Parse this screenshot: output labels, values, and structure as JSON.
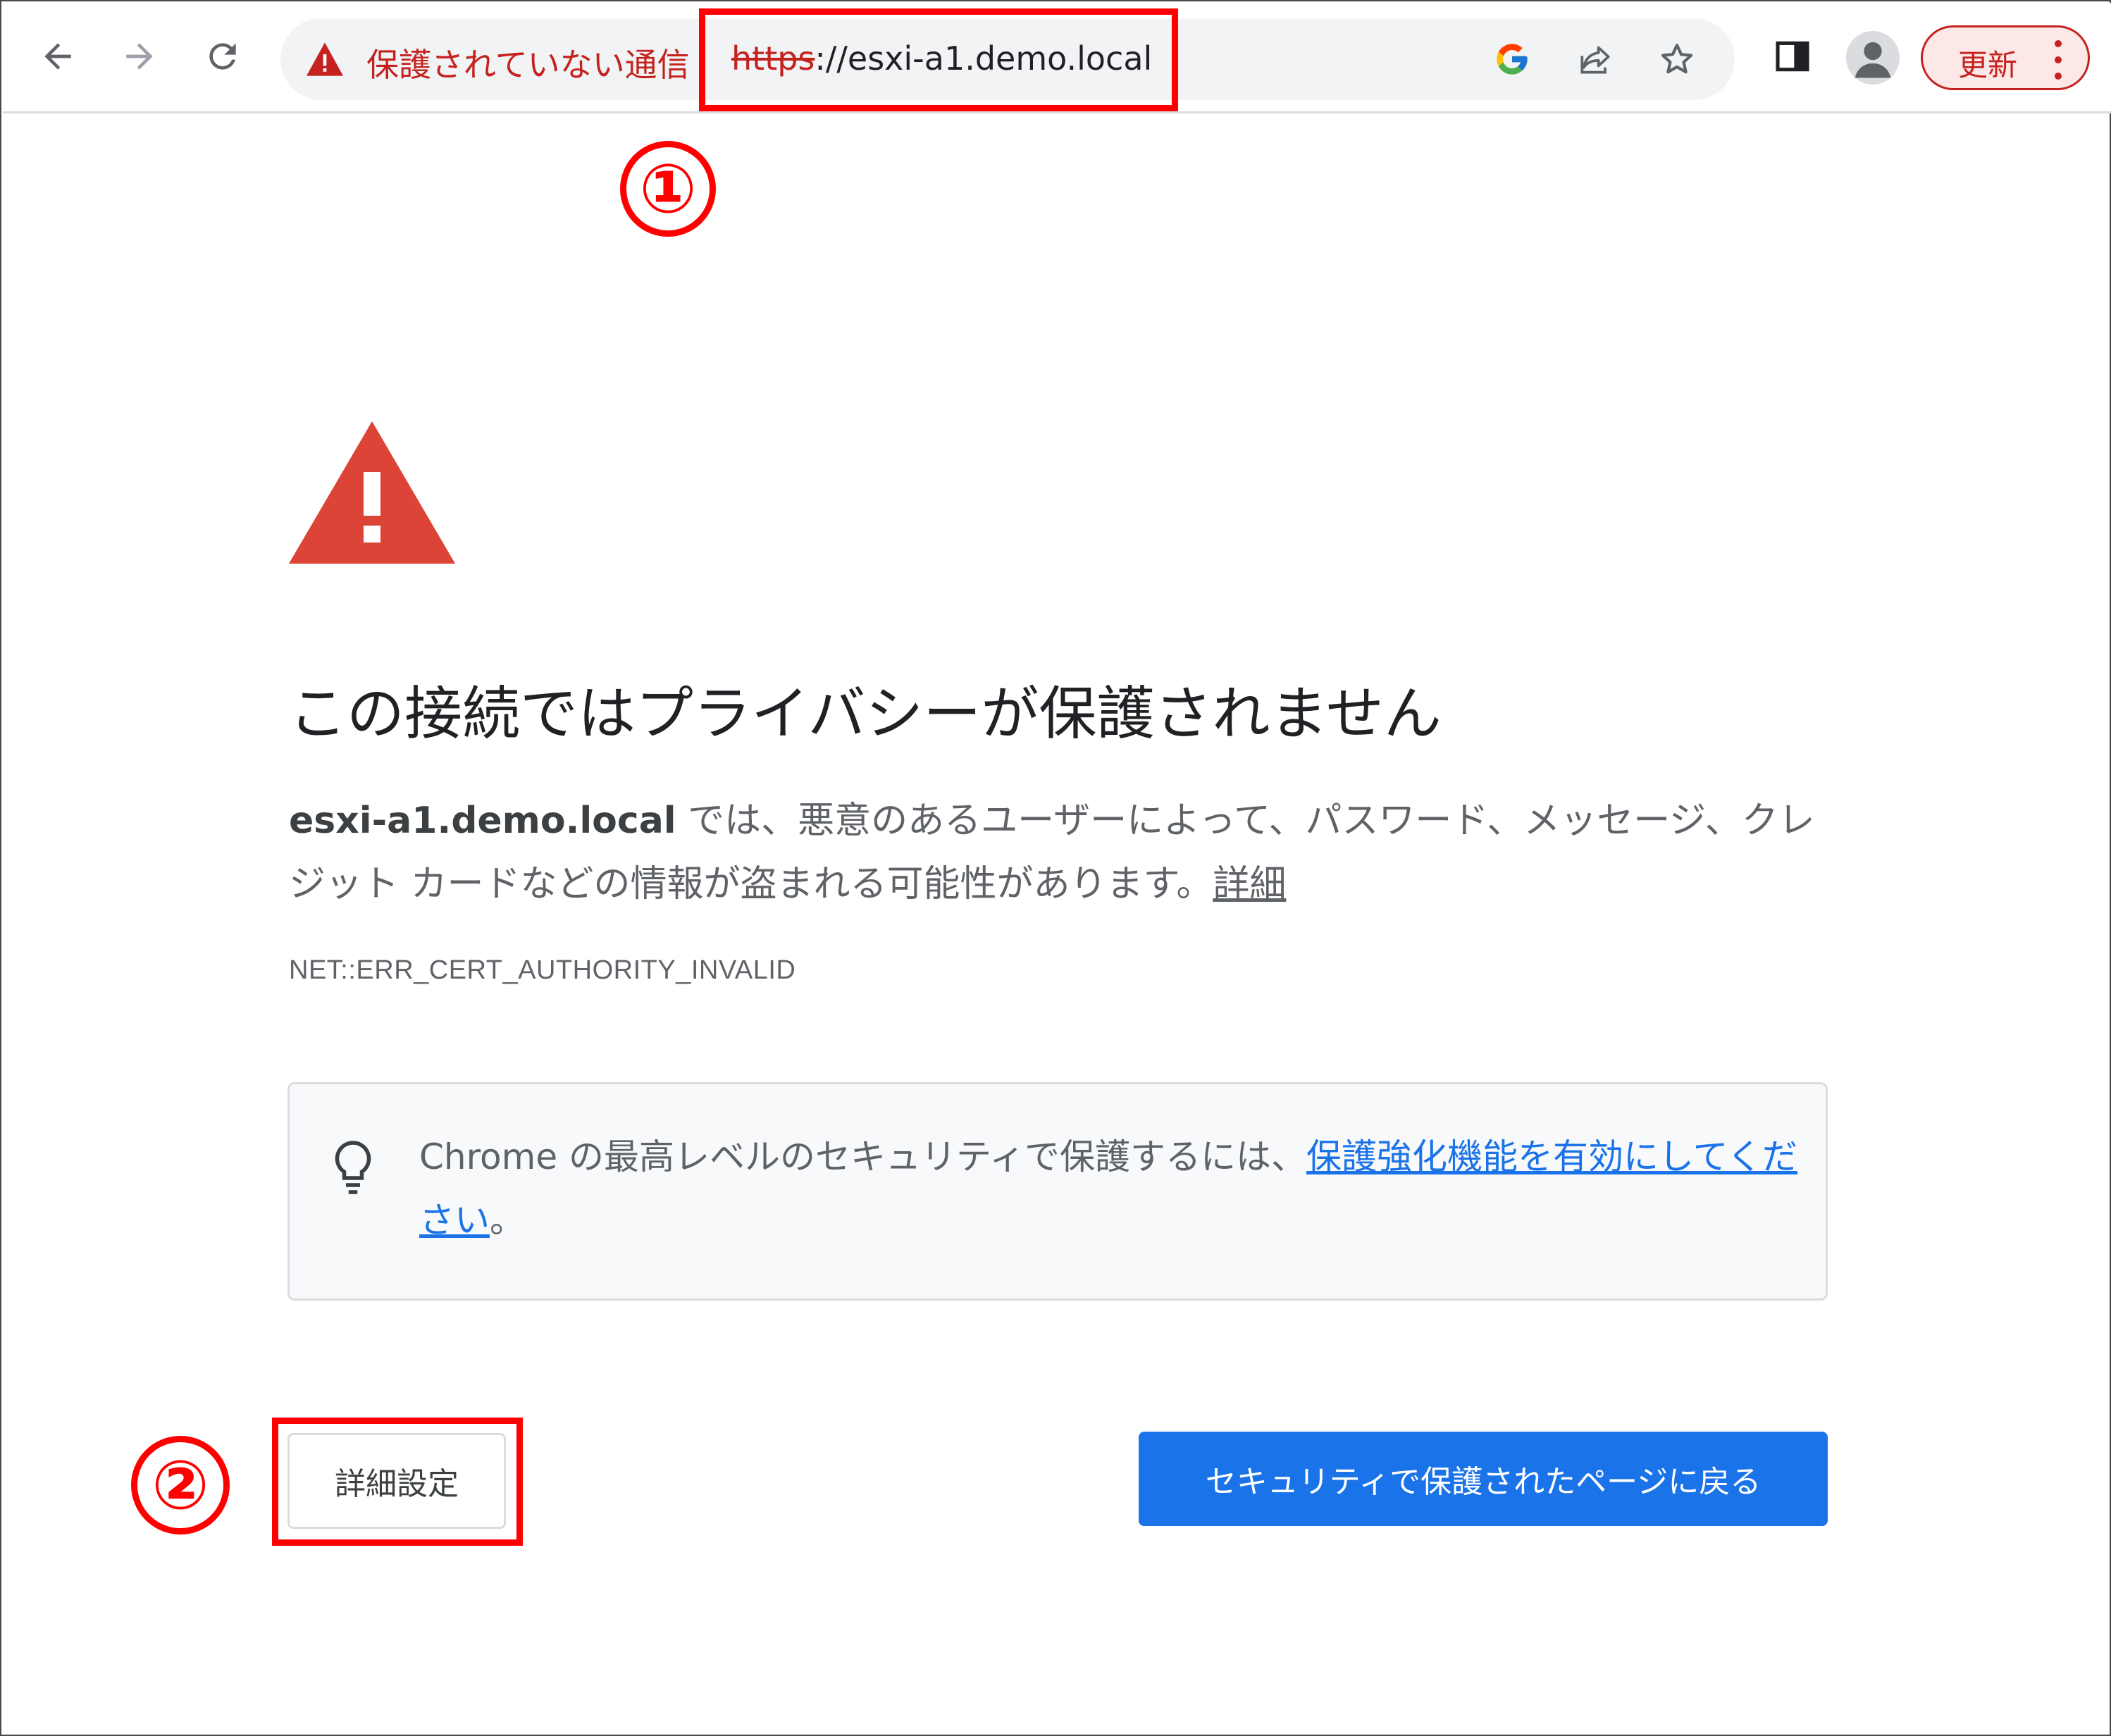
{
  "toolbar": {
    "security_text": "保護されていない通信",
    "url_scheme": "https",
    "url_rest": "://esxi-a1.demo.local",
    "update_label": "更新"
  },
  "annotations": {
    "step1": "①",
    "step2": "②"
  },
  "interstitial": {
    "heading": "この接続ではプライバシーが保護されません",
    "host": "esxi-a1.demo.local",
    "message": " では、悪意のあるユーザーによって、パスワード、メッセージ、クレジット カードなどの情報が盗まれる可能性があります。",
    "learn_more": "詳細",
    "error_code": "NET::ERR_CERT_AUTHORITY_INVALID",
    "tip_prefix": "Chrome の最高レベルのセキュリティで保護するには、",
    "tip_link": "保護強化機能を有効にしてください",
    "tip_suffix": "。",
    "details_button": "詳細設定",
    "back_button": "セキュリティで保護されたページに戻る"
  },
  "colors": {
    "danger": "#c5221f",
    "annotation": "#ff0000",
    "primary": "#1a73e8",
    "warning_triangle": "#db4437"
  }
}
